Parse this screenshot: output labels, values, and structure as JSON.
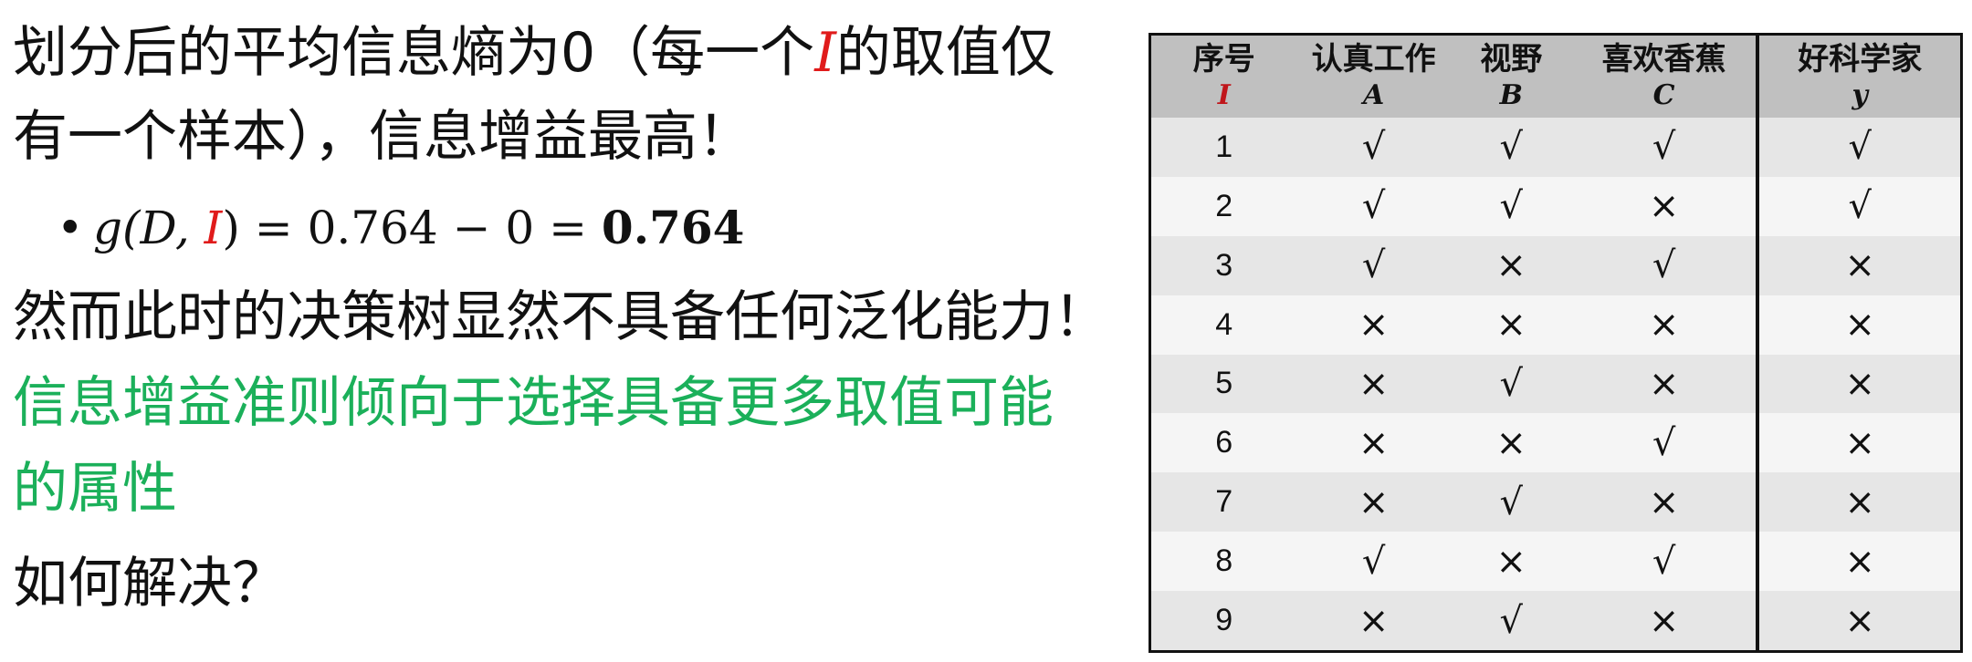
{
  "left": {
    "line1": {
      "pre": "划分后的平均信息熵为0（每一个",
      "var": "I",
      "post": "的取值仅"
    },
    "line2": "有一个样本），信息增益最高！",
    "formula": {
      "bullet": "•",
      "g": "g",
      "open": "(D, ",
      "var": "I",
      "rest": ") = 0.764 − 0 = ",
      "result": "0.764"
    },
    "line4": "然而此时的决策树显然不具备任何泛化能力！",
    "line5": "信息增益准则倾向于选择具备更多取值可能",
    "line6": "的属性",
    "line7": "如何解决？"
  },
  "table": {
    "headers": [
      {
        "label": "序号",
        "sym": "I"
      },
      {
        "label": "认真工作",
        "sym": "A"
      },
      {
        "label": "视野",
        "sym": "B"
      },
      {
        "label": "喜欢香蕉",
        "sym": "C"
      },
      {
        "label": "好科学家",
        "sym": "y"
      }
    ],
    "rows": [
      [
        "1",
        "√",
        "√",
        "√",
        "√"
      ],
      [
        "2",
        "√",
        "√",
        "×",
        "√"
      ],
      [
        "3",
        "√",
        "×",
        "√",
        "×"
      ],
      [
        "4",
        "×",
        "×",
        "×",
        "×"
      ],
      [
        "5",
        "×",
        "√",
        "×",
        "×"
      ],
      [
        "6",
        "×",
        "×",
        "√",
        "×"
      ],
      [
        "7",
        "×",
        "√",
        "×",
        "×"
      ],
      [
        "8",
        "√",
        "×",
        "√",
        "×"
      ],
      [
        "9",
        "×",
        "√",
        "×",
        "×"
      ]
    ]
  },
  "colors": {
    "highlight_red": "#e01b1b",
    "green_text": "#1bb05a",
    "header_bg": "#c0c0c0"
  }
}
